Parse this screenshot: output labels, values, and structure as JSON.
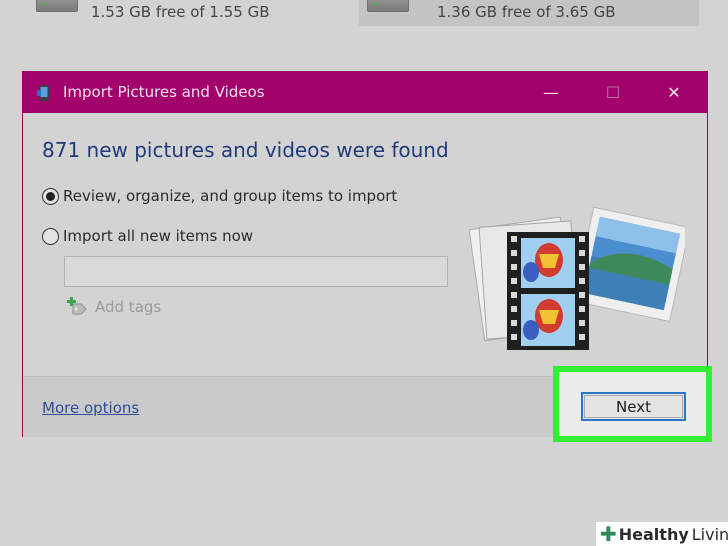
{
  "background": {
    "drives": [
      {
        "free_text": "1.53 GB free of 1.55 GB"
      },
      {
        "free_text": "1.36 GB free of 3.65 GB"
      }
    ]
  },
  "dialog": {
    "title": "Import Pictures and Videos",
    "controls": {
      "minimize": "—",
      "maximize": "☐",
      "close": "✕"
    },
    "headline": "871 new pictures and videos were found",
    "options": [
      {
        "label": "Review, organize, and group items to import",
        "selected": true
      },
      {
        "label": "Import all new items now",
        "selected": false
      }
    ],
    "tag_input": {
      "value": "",
      "placeholder": ""
    },
    "add_tags_label": "Add tags",
    "more_options_label": "More options",
    "next_label": "Next"
  },
  "watermark": {
    "part1": "Healthy",
    "part2": "Living"
  },
  "colors": {
    "titlebar": "#a2006b",
    "highlight": "#33ee33",
    "headline": "#203a7a",
    "link": "#2d4f99",
    "button_border": "#2f73c7"
  },
  "icons": {
    "app": "phone-import-icon",
    "drive": "hard-drive-icon",
    "tags": "add-tags-icon",
    "media": "photos-and-film-icon"
  }
}
